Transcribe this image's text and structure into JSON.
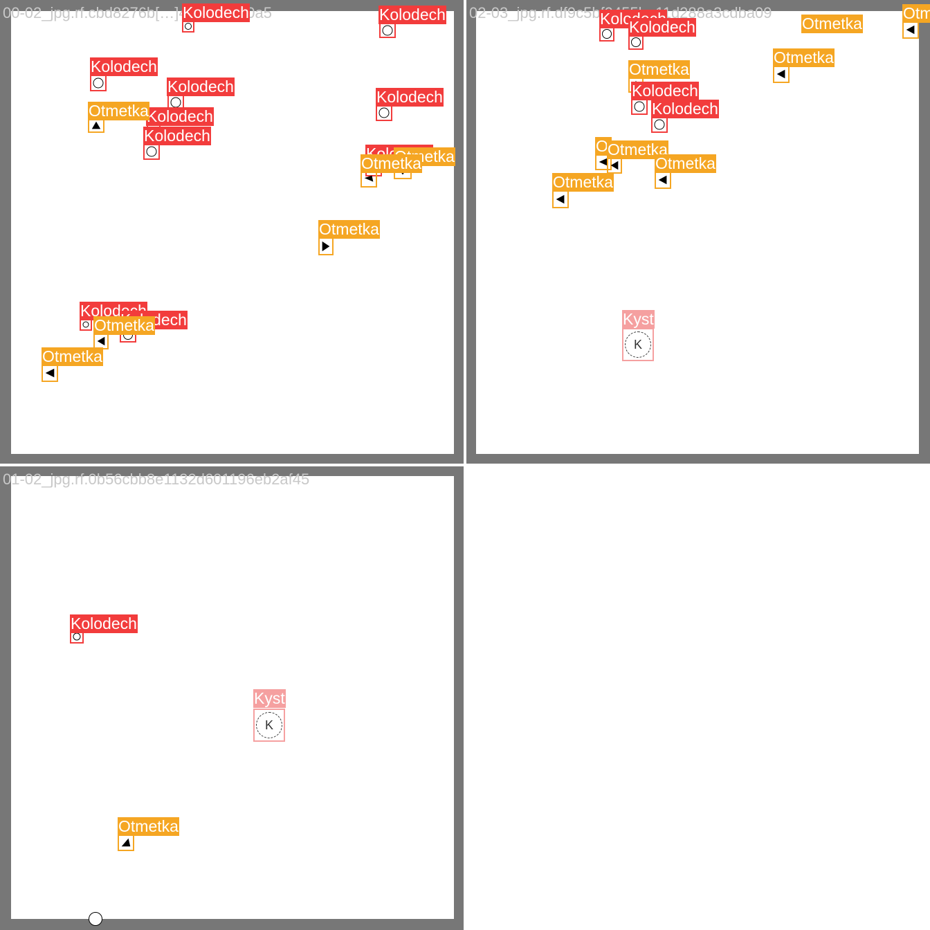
{
  "tiles": [
    {
      "filename": "00-02_jpg.rf.cbd8276b[…]4ea16eaa0a5"
    },
    {
      "filename": "02-03_jpg.rf.df9c5bf9455ba11d288a3cdba09"
    },
    {
      "filename": "01-02_jpg.rf.0b56cbb8e1132d601196eb2af45"
    }
  ],
  "labels": {
    "kolodech": "Kolodech",
    "otmetka": "Otmetka",
    "kyst": "Kyst",
    "kyst_symbol": "K"
  },
  "colors": {
    "kolodech": "#f23c3c",
    "otmetka": "#f5a623",
    "kyst": "#f5a0a0",
    "tile_border": "#777777"
  }
}
